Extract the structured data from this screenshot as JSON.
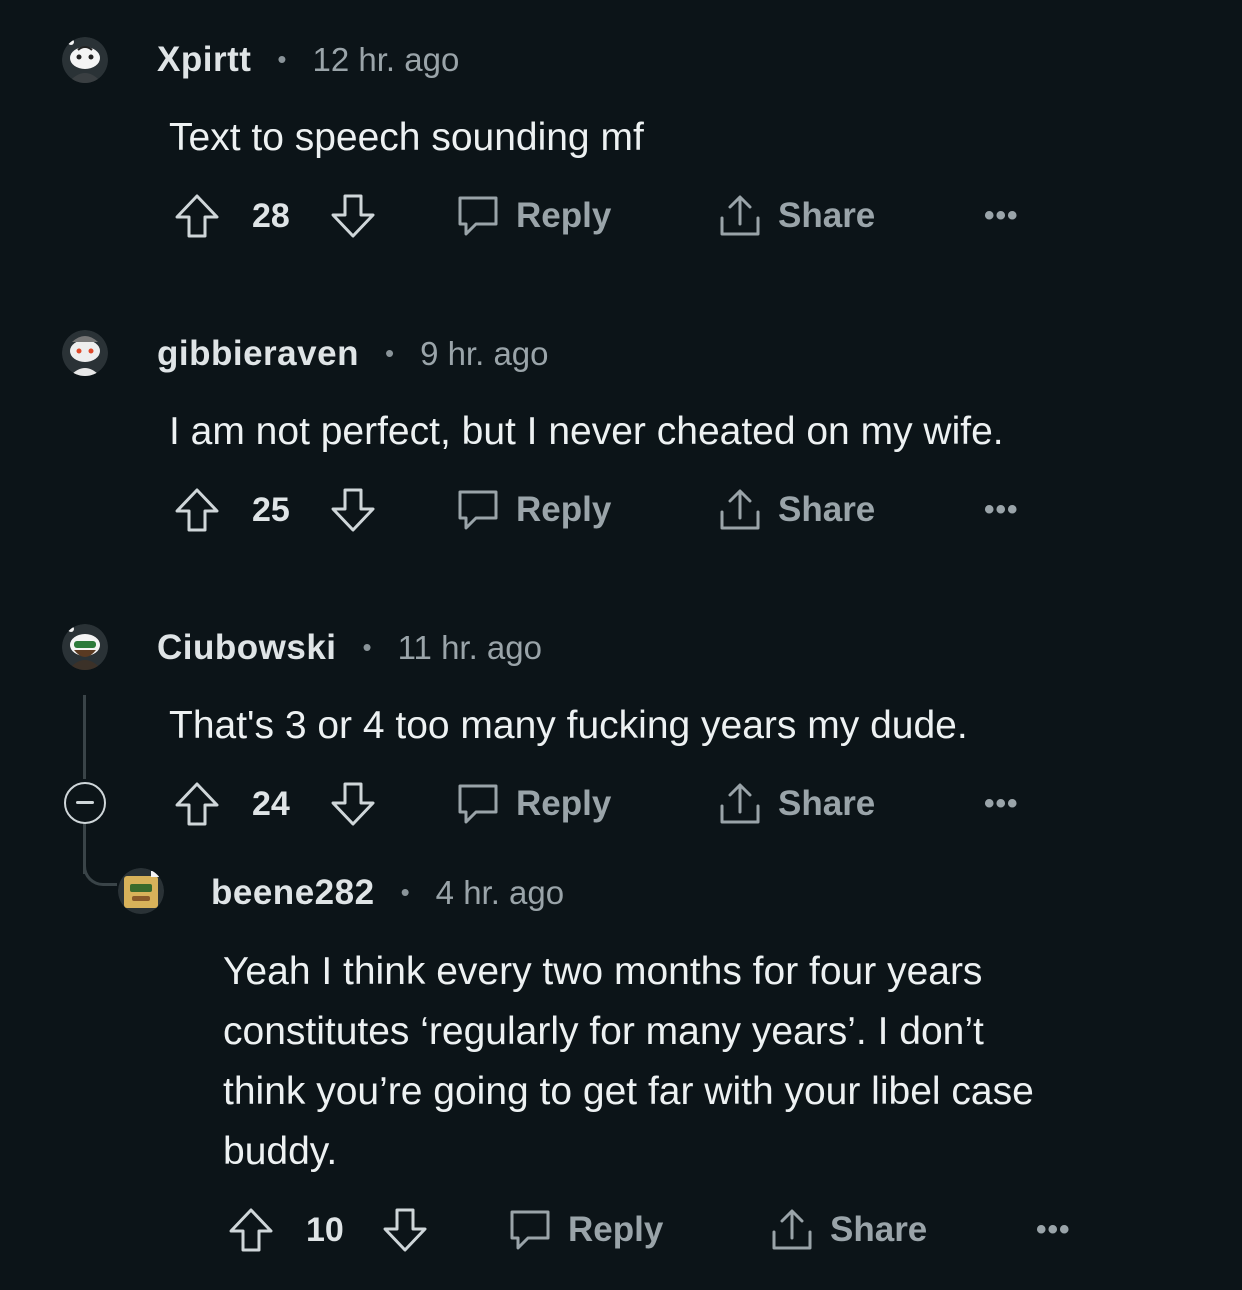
{
  "comments": [
    {
      "username": "Xpirtt",
      "separator": "•",
      "time": "12 hr. ago",
      "text": "Text to speech sounding mf",
      "votes": "28",
      "reply_label": "Reply",
      "share_label": "Share",
      "more_label": "•••"
    },
    {
      "username": "gibbieraven",
      "separator": "•",
      "time": "9 hr. ago",
      "text": "I am not perfect, but I never cheated on my wife.",
      "votes": "25",
      "reply_label": "Reply",
      "share_label": "Share",
      "more_label": "•••"
    },
    {
      "username": "Ciubowski",
      "separator": "•",
      "time": "11 hr. ago",
      "text": "That's 3 or 4 too many fucking years my dude.",
      "votes": "24",
      "reply_label": "Reply",
      "share_label": "Share",
      "more_label": "•••"
    },
    {
      "username": "beene282",
      "separator": "•",
      "time": "4 hr. ago",
      "text_lines": [
        "Yeah I think every two months for four years",
        "constitutes ‘regularly for many years’. I don’t",
        "think you’re going to get far with your libel case",
        "buddy."
      ],
      "votes": "10",
      "reply_label": "Reply",
      "share_label": "Share",
      "more_label": "•••"
    }
  ],
  "colors": {
    "background": "#0c1418",
    "text": "#edf1f2",
    "muted": "#9aa4a9",
    "thread_line": "#3a4448"
  },
  "icons": [
    "snoo-avatar-icon",
    "upvote-arrow-icon",
    "downvote-arrow-icon",
    "reply-bubble-icon",
    "share-icon",
    "more-options-icon",
    "collapse-thread-icon"
  ]
}
